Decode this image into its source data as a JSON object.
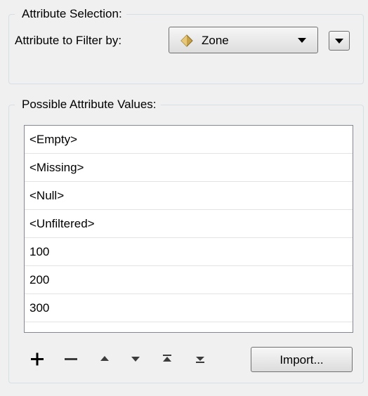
{
  "attribute_selection": {
    "title": "Attribute Selection:",
    "filter_label": "Attribute to Filter by:",
    "selected_attribute": "Zone",
    "attribute_icon": "attribute-diamond-icon",
    "icon_color": "#c8a24a"
  },
  "possible_values": {
    "title": "Possible Attribute Values:",
    "items": [
      "<Empty>",
      "<Missing>",
      "<Null>",
      "<Unfiltered>",
      "100",
      "200",
      "300"
    ],
    "toolbar": {
      "add_icon": "plus-icon",
      "remove_icon": "minus-icon",
      "move_up_icon": "arrow-up-icon",
      "move_down_icon": "arrow-down-icon",
      "move_top_icon": "move-to-top-icon",
      "move_bottom_icon": "move-to-bottom-icon",
      "import_label": "Import..."
    }
  }
}
